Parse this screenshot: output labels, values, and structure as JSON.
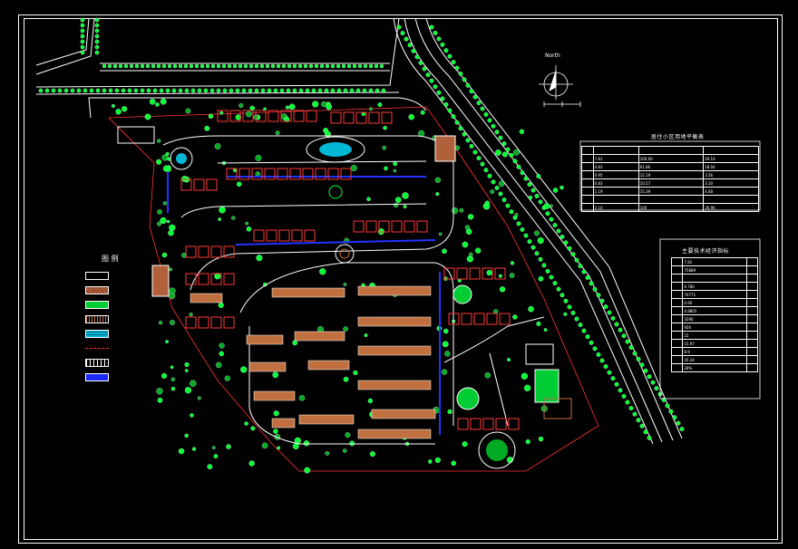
{
  "drawing": {
    "north_label": "North",
    "road_labels": []
  },
  "legend": {
    "title": "图 例",
    "items": [
      {
        "id": "existing",
        "label": "",
        "fill": "none",
        "stroke": "#ffffff",
        "pattern": "white-box"
      },
      {
        "id": "planned",
        "label": "",
        "fill": "#b0603a",
        "stroke": "#ffffff",
        "pattern": "brown-hatch"
      },
      {
        "id": "green",
        "label": "",
        "fill": "#00cc33",
        "stroke": "#ffffff",
        "pattern": "green"
      },
      {
        "id": "paving",
        "label": "",
        "fill": "#c07050",
        "stroke": "#ffffff",
        "pattern": "dots"
      },
      {
        "id": "water",
        "label": "",
        "fill": "#00b7d6",
        "stroke": "#ffffff",
        "pattern": "water"
      },
      {
        "id": "boundary",
        "label": "",
        "fill": "none",
        "stroke": "#ff3333",
        "pattern": "redline"
      },
      {
        "id": "parking",
        "label": "",
        "fill": "none",
        "stroke": "#ffffff",
        "pattern": "stripes"
      },
      {
        "id": "road",
        "label": "",
        "fill": "#1a2aff",
        "stroke": "#ffffff",
        "pattern": "blue"
      }
    ]
  },
  "colors": {
    "tree": "#00ff33",
    "tree_dark": "#00aa22",
    "road": "#ffffff",
    "building": "#c0703f",
    "building_red": "#ff3a3a",
    "water": "#00d0ff",
    "boundary": "#ff3333",
    "blue_road": "#2233ff"
  },
  "table1": {
    "title": "居住小区用地平衡表",
    "header": [
      "",
      "",
      "",
      ""
    ],
    "rows": [
      [
        "",
        "7.81",
        "100.00",
        "29.16"
      ],
      [
        "",
        "4.83",
        "61.86",
        "18.04"
      ],
      [
        "",
        "0.95",
        "12.19",
        "3.56"
      ],
      [
        "",
        "0.83",
        "10.57",
        "3.10"
      ],
      [
        "",
        "1.19",
        "15.39",
        "4.48"
      ],
      [
        "",
        "",
        "",
        ""
      ],
      [
        "",
        "2.10",
        "100",
        "26.96"
      ]
    ]
  },
  "table2": {
    "title": "主要技术经济指标",
    "rows": [
      [
        "",
        "7.81",
        ""
      ],
      [
        "",
        "75889",
        ""
      ],
      [
        "",
        "",
        ""
      ],
      [
        "",
        "6.780",
        ""
      ],
      [
        "",
        "70771",
        ""
      ],
      [
        "",
        "0.90",
        ""
      ],
      [
        "",
        "4.8805",
        ""
      ],
      [
        "",
        "3290",
        ""
      ],
      [
        "",
        "926",
        ""
      ],
      [
        "",
        "22",
        ""
      ],
      [
        "",
        "15.97",
        ""
      ],
      [
        "",
        "8.9",
        ""
      ],
      [
        "",
        "35.24",
        ""
      ],
      [
        "",
        "28%",
        ""
      ]
    ]
  }
}
